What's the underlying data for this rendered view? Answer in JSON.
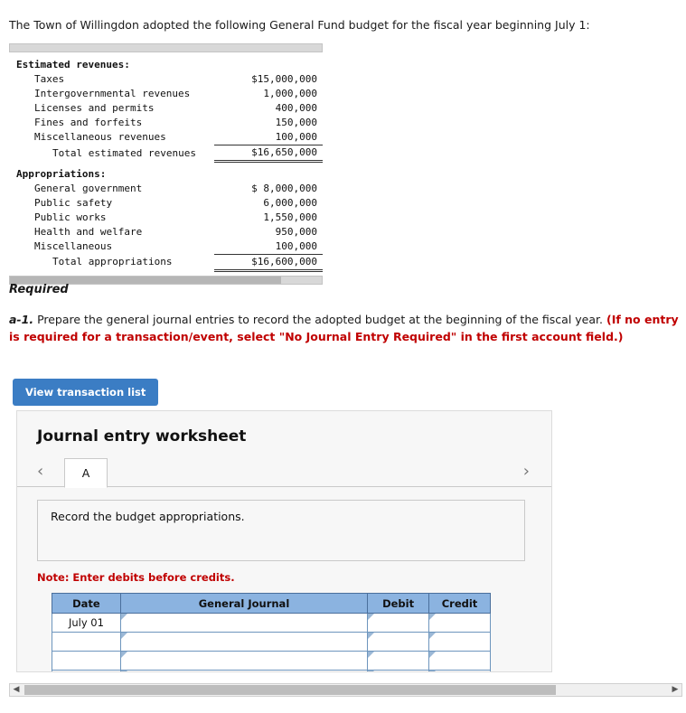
{
  "intro": "The Town of Willingdon adopted the following General Fund budget for the fiscal year beginning July 1:",
  "budget": {
    "section1_title": "Estimated revenues:",
    "rows1": [
      {
        "label": "Taxes",
        "amount": "$15,000,000"
      },
      {
        "label": "Intergovernmental revenues",
        "amount": "1,000,000"
      },
      {
        "label": "Licenses and permits",
        "amount": "400,000"
      },
      {
        "label": "Fines and forfeits",
        "amount": "150,000"
      },
      {
        "label": "Miscellaneous revenues",
        "amount": "100,000"
      }
    ],
    "total1_label": "Total estimated revenues",
    "total1_amount": "$16,650,000",
    "section2_title": "Appropriations:",
    "rows2": [
      {
        "label": "General government",
        "amount": "$ 8,000,000"
      },
      {
        "label": "Public safety",
        "amount": "6,000,000"
      },
      {
        "label": "Public works",
        "amount": "1,550,000"
      },
      {
        "label": "Health and welfare",
        "amount": "950,000"
      },
      {
        "label": "Miscellaneous",
        "amount": "100,000"
      }
    ],
    "total2_label": "Total appropriations",
    "total2_amount": "$16,600,000"
  },
  "required": {
    "heading": "Required",
    "item_label": "a-1.",
    "item_text": "Prepare the general journal entries to record the adopted budget at the beginning of the fiscal year.",
    "item_note": "(If no entry is required for a transaction/event, select \"No Journal Entry Required\" in the first account field.)"
  },
  "view_transaction_button": "View transaction list",
  "worksheet": {
    "title": "Journal entry worksheet",
    "prev_arrow": "‹",
    "next_arrow": "›",
    "tabs": [
      {
        "label": "A"
      }
    ],
    "entry_description": "Record the budget appropriations.",
    "note": "Note: Enter debits before credits.",
    "table": {
      "headers": [
        "Date",
        "General Journal",
        "Debit",
        "Credit"
      ],
      "rows": [
        {
          "date": "July 01",
          "account": "",
          "debit": "",
          "credit": ""
        },
        {
          "date": "",
          "account": "",
          "debit": "",
          "credit": ""
        },
        {
          "date": "",
          "account": "",
          "debit": "",
          "credit": ""
        },
        {
          "date": "",
          "account": "",
          "debit": "",
          "credit": ""
        }
      ]
    }
  },
  "scrollbar": {
    "left_arrow": "◀",
    "right_arrow": "▶"
  },
  "colors": {
    "accent": "#3b7dc4",
    "header": "#8bb3e0",
    "alert": "#c00000"
  }
}
